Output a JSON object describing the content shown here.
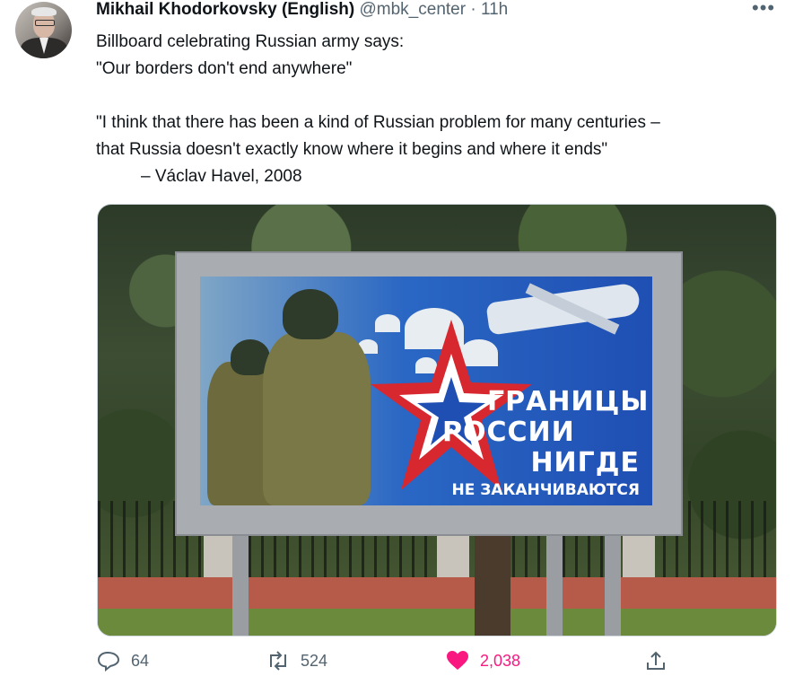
{
  "tweet": {
    "author_name": "Mikhail Khodorkovsky (English)",
    "author_handle": "@mbk_center",
    "separator": "·",
    "time": "11h",
    "more_label": "•••",
    "text_lines": [
      "Billboard celebrating Russian army says:",
      "\"Our borders don't end anywhere\"",
      "",
      "\"I think that there has been a kind of Russian problem for many centuries –",
      "that Russia doesn't exactly know where it begins and where it ends\"",
      "– Václav Havel, 2008"
    ]
  },
  "media": {
    "billboard_text": [
      "ГРАНИЦЫ",
      "РОССИИ",
      "НИГДЕ",
      "НЕ ЗАКАНЧИВАЮТСЯ"
    ]
  },
  "actions": {
    "reply_count": "64",
    "retweet_count": "524",
    "like_count": "2,038",
    "like_color": "#f91880",
    "icons": [
      "reply-icon",
      "retweet-icon",
      "heart-icon",
      "share-icon"
    ]
  }
}
